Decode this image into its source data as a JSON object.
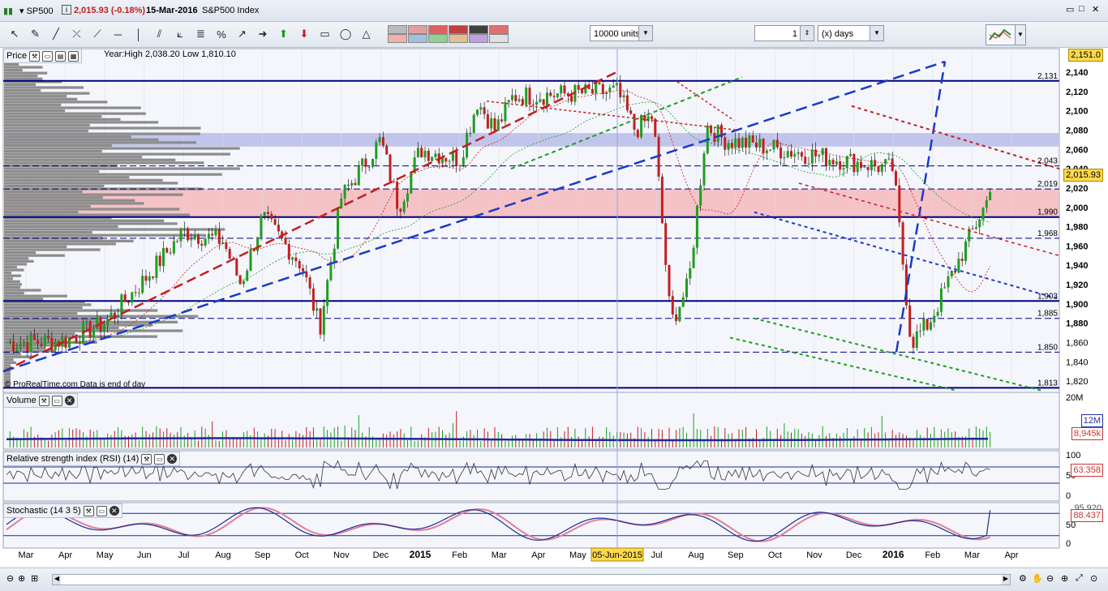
{
  "header": {
    "symbol": "SP500",
    "last_price": "2,015.93 (-0.18%)",
    "date": "15-Mar-2016",
    "instrument_name": "S&P500 Index"
  },
  "toolbar": {
    "units_value": "10000 units",
    "period_value": "1",
    "period_unit": "(x) days",
    "tools": [
      "cursor-icon",
      "pencil-icon",
      "line-tool-icon",
      "cross-line-icon",
      "trendline-icon",
      "horizontal-line-icon",
      "vertical-line-icon",
      "channel-icon",
      "fan-icon",
      "fibonacci-icon",
      "fibonacci-percent-icon",
      "arrows-icon",
      "arrow-right-icon",
      "arrow-up-green-icon",
      "arrow-down-red-icon",
      "rectangle-icon",
      "ellipse-icon",
      "triangle-icon"
    ],
    "colors": [
      "#bbbbbb",
      "#e0a0a0",
      "#e06060",
      "#c04040",
      "#404040",
      "#e07070",
      "#f0b0b0",
      "#a0c0e0",
      "#90d090",
      "#e0c090",
      "#c0a0e0",
      "#e0e0e0"
    ]
  },
  "price_panel": {
    "title": "Price",
    "info": "Year:High 2,038.20 Low 1,810.10",
    "watermark": "© ProRealTime.com  Data is end of day",
    "current_tag": "2,015.93",
    "top_tag": "2,151.0",
    "level_labels": [
      "2,131",
      "2,043",
      "2,019",
      "1,990",
      "1,968",
      "1,903",
      "1,885",
      "1,850",
      "1,813"
    ]
  },
  "volume_panel": {
    "title": "Volume",
    "tag_ma": "12M",
    "tag_last": "8,945k"
  },
  "rsi_panel": {
    "title": "Relative strength index (RSI) (14)",
    "tag": "63.358"
  },
  "stoch_panel": {
    "title": "Stochastic (14 3 5)",
    "tag": "88.437",
    "tag_top": "95.920"
  },
  "x_axis": {
    "highlight": "05-Jun-2015"
  },
  "chart_data": {
    "type": "candlestick",
    "title": "S&P500 Index",
    "x_axis_labels": [
      "Mar",
      "Apr",
      "May",
      "Jun",
      "Jul",
      "Aug",
      "Sep",
      "Oct",
      "Nov",
      "Dec",
      "2015",
      "Feb",
      "Mar",
      "Apr",
      "May",
      "05-Jun-2015",
      "Jul",
      "Aug",
      "Sep",
      "Oct",
      "Nov",
      "Dec",
      "2016",
      "Feb",
      "Mar",
      "Apr"
    ],
    "y_ticks": [
      1820,
      1840,
      1860,
      1880,
      1900,
      1920,
      1940,
      1960,
      1980,
      2000,
      2020,
      2040,
      2060,
      2080,
      2100,
      2120,
      2140
    ],
    "ylim": [
      1810,
      2151
    ],
    "horizontal_levels": [
      {
        "value": 2131,
        "style": "solid"
      },
      {
        "value": 2043,
        "style": "dashed"
      },
      {
        "value": 2019,
        "style": "dashed"
      },
      {
        "value": 1990,
        "style": "solid"
      },
      {
        "value": 1968,
        "style": "dashed"
      },
      {
        "value": 1903,
        "style": "solid"
      },
      {
        "value": 1885,
        "style": "dashed"
      },
      {
        "value": 1850,
        "style": "dashed"
      },
      {
        "value": 1813,
        "style": "solid"
      }
    ],
    "zones": [
      {
        "from": 2063,
        "to": 2077,
        "color": "#b8bce8"
      },
      {
        "from": 1990,
        "to": 2019,
        "color": "#f5b8bc"
      }
    ],
    "close_path": [
      [
        "Mar",
        1860
      ],
      [
        "Apr",
        1862
      ],
      [
        "May",
        1880
      ],
      [
        "Jun",
        1925
      ],
      [
        "Jul",
        1975
      ],
      [
        "Aug",
        1965
      ],
      [
        "Aug",
        1920
      ],
      [
        "Sep",
        1990
      ],
      [
        "Oct",
        1940
      ],
      [
        "Oct",
        1875
      ],
      [
        "Nov",
        2010
      ],
      [
        "Dec",
        2070
      ],
      [
        "Dec",
        2000
      ],
      [
        "2015",
        2060
      ],
      [
        "Feb",
        2050
      ],
      [
        "Mar",
        2110
      ],
      [
        "Apr",
        2080
      ],
      [
        "May",
        2115
      ],
      [
        "05-Jun-2015",
        2120
      ],
      [
        "Jul",
        2080
      ],
      [
        "Aug",
        2095
      ],
      [
        "Sep",
        1880
      ],
      [
        "Oct",
        1920
      ],
      [
        "Nov",
        2085
      ],
      [
        "Dec",
        2070
      ],
      [
        "2016",
        2040
      ],
      [
        "Feb",
        1860
      ],
      [
        "Mar",
        1880
      ],
      [
        "Apr",
        2016
      ]
    ],
    "last_close": 2015.93,
    "volume_ylim": [
      0,
      20000000
    ],
    "volume_ticks": [
      "20M"
    ],
    "rsi_ticks": [
      0,
      50,
      100
    ],
    "rsi_last": 63.358,
    "stoch_ticks": [
      0,
      50
    ],
    "stoch_last": 88.437
  }
}
